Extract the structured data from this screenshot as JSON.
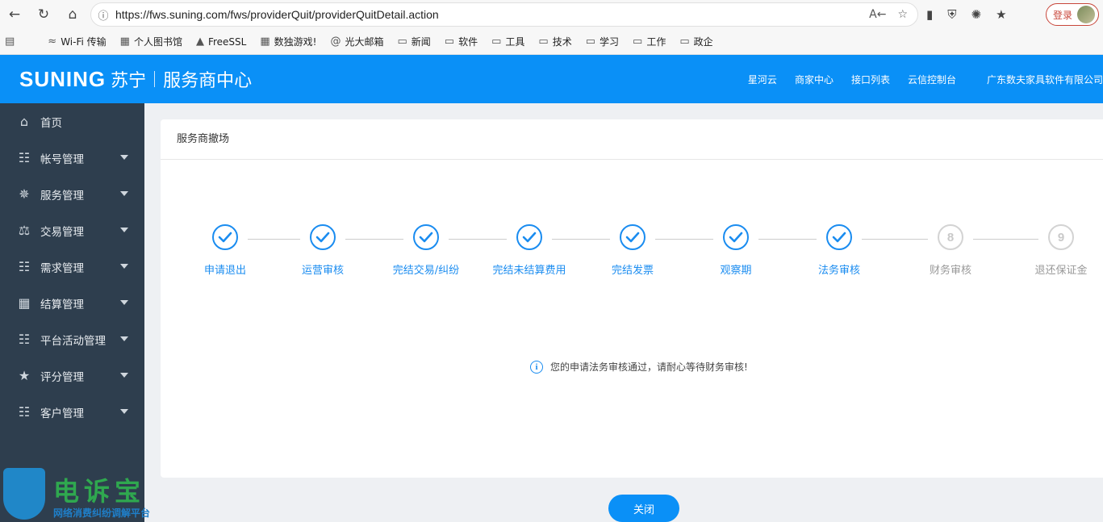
{
  "browser": {
    "url": "https://fws.suning.com/fws/providerQuit/providerQuitDetail.action",
    "login_label": "登录",
    "bookmarks": [
      {
        "label": "Wi-Fi 传输",
        "icon": "wifi-icon"
      },
      {
        "label": "个人图书馆",
        "icon": "library-icon"
      },
      {
        "label": "FreeSSL",
        "icon": "lock-icon"
      },
      {
        "label": "数独游戏!",
        "icon": "grid-icon"
      },
      {
        "label": "光大邮箱",
        "icon": "mail-icon"
      },
      {
        "label": "新闻",
        "icon": "folder-icon"
      },
      {
        "label": "软件",
        "icon": "folder-icon"
      },
      {
        "label": "工具",
        "icon": "folder-icon"
      },
      {
        "label": "技术",
        "icon": "folder-icon"
      },
      {
        "label": "学习",
        "icon": "folder-icon"
      },
      {
        "label": "工作",
        "icon": "folder-icon"
      },
      {
        "label": "政企",
        "icon": "folder-icon"
      }
    ]
  },
  "header": {
    "brand": "SUNING",
    "brand_cn": "苏宁",
    "center_name": "服务商中心",
    "links": [
      "星河云",
      "商家中心",
      "接口列表",
      "云信控制台"
    ],
    "company": "广东数夫家具软件有限公司"
  },
  "sidebar": {
    "items": [
      {
        "label": "首页",
        "icon": "home-icon",
        "has_caret": false
      },
      {
        "label": "帐号管理",
        "icon": "clipboard-icon",
        "has_caret": true
      },
      {
        "label": "服务管理",
        "icon": "service-icon",
        "has_caret": true
      },
      {
        "label": "交易管理",
        "icon": "scale-icon",
        "has_caret": true
      },
      {
        "label": "需求管理",
        "icon": "clipboard-icon",
        "has_caret": true
      },
      {
        "label": "结算管理",
        "icon": "calculator-icon",
        "has_caret": true
      },
      {
        "label": "平台活动管理",
        "icon": "clipboard-icon",
        "has_caret": true
      },
      {
        "label": "评分管理",
        "icon": "star-icon",
        "has_caret": true
      },
      {
        "label": "客户管理",
        "icon": "clipboard-icon",
        "has_caret": true
      }
    ]
  },
  "main": {
    "title": "服务商撤场",
    "steps": [
      {
        "label": "申请退出",
        "status": "done",
        "number": "1"
      },
      {
        "label": "运营审核",
        "status": "done",
        "number": "2"
      },
      {
        "label": "完结交易/纠纷",
        "status": "done",
        "number": "3"
      },
      {
        "label": "完结未结算费用",
        "status": "done",
        "number": "4"
      },
      {
        "label": "完结发票",
        "status": "done",
        "number": "5"
      },
      {
        "label": "观察期",
        "status": "done",
        "number": "6"
      },
      {
        "label": "法务审核",
        "status": "done",
        "number": "7"
      },
      {
        "label": "财务审核",
        "status": "todo",
        "number": "8"
      },
      {
        "label": "退还保证金",
        "status": "todo",
        "number": "9"
      }
    ],
    "notice": "您的申请法务审核通过，请耐心等待财务审核!",
    "close_label": "关闭"
  },
  "watermark": {
    "title": "电诉宝",
    "subtitle": "网络消费纠纷调解平台"
  },
  "colors": {
    "accent": "#0a90f7",
    "sidebar_bg": "#2e3e4e",
    "step_done": "#1a8cf0",
    "step_todo": "#d3d3d3"
  }
}
